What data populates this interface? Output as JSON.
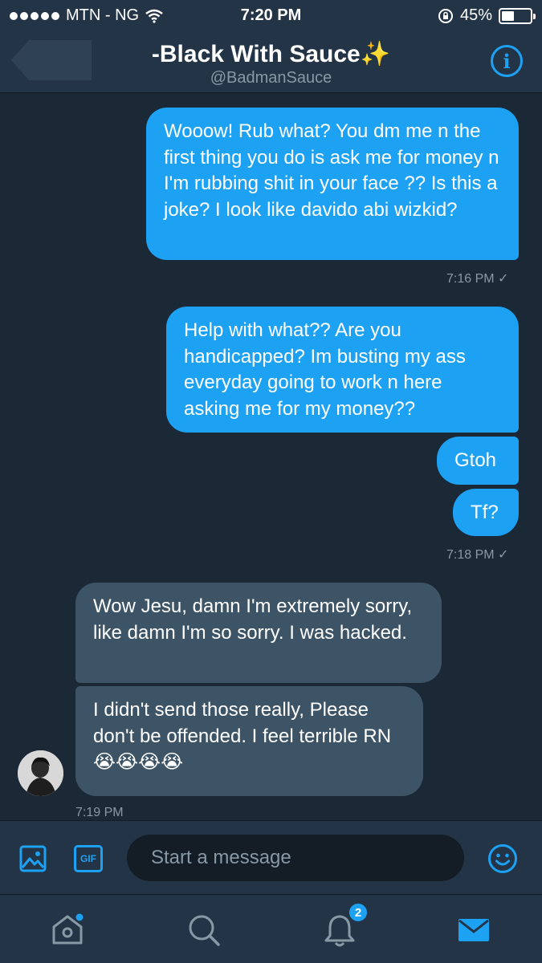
{
  "status_bar": {
    "carrier": "MTN - NG",
    "time": "7:20 PM",
    "battery": "45%",
    "battery_level": 0.45
  },
  "header": {
    "title": "-Black With Sauce✨",
    "handle": "@BadmanSauce",
    "info_label": "i"
  },
  "messages": [
    {
      "dir": "sent",
      "text": "Wooow! Rub what? You dm me n the first thing you do is  ask me for money n I'm rubbing shit in your face ?? Is this a joke? I look like davido abi wizkid?"
    },
    {
      "dir": "sent",
      "text": "Help with what?? Are you handicapped? Im busting my ass everyday going to work n here asking me for my money??"
    },
    {
      "dir": "sent",
      "text": "Gtoh"
    },
    {
      "dir": "sent",
      "text": "Tf?"
    },
    {
      "dir": "received",
      "text": "Wow Jesu, damn I'm extremely sorry, like damn I'm so sorry. I was hacked."
    },
    {
      "dir": "received",
      "text": "I didn't send those really, Please don't be offended. I feel terrible RN😭😭😭😭"
    }
  ],
  "timestamps": {
    "t1": "7:16 PM ✓",
    "t2": "7:18 PM ✓",
    "t3": "7:19 PM"
  },
  "composer": {
    "placeholder": "Start a message",
    "gif_label": "GIF"
  },
  "tabbar": {
    "notifications_badge": "2"
  },
  "colors": {
    "accent": "#1da1f2",
    "background": "#1b2836",
    "bar": "#243447",
    "received_bubble": "#3d5466"
  }
}
